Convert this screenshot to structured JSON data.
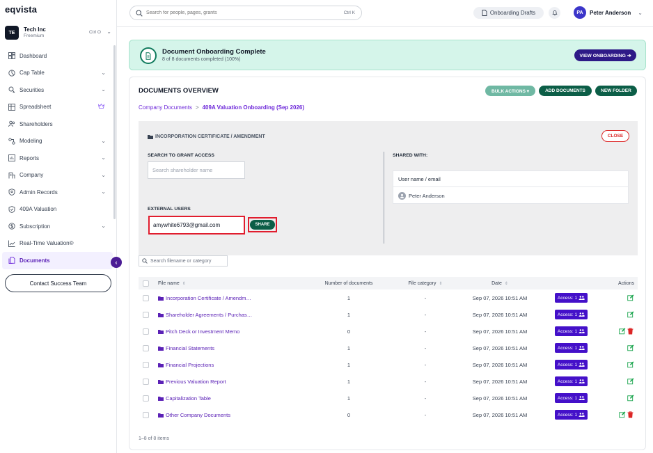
{
  "brand": {
    "logo": "eqvista"
  },
  "org": {
    "initials": "TE",
    "name": "Tech Inc",
    "plan": "Freemium",
    "shortcut": "Ctrl O"
  },
  "nav": [
    {
      "label": "Dashboard",
      "icon": "dashboard-icon",
      "chevron": false
    },
    {
      "label": "Cap Table",
      "icon": "pie-chart-icon",
      "chevron": true
    },
    {
      "label": "Securities",
      "icon": "securities-icon",
      "chevron": true
    },
    {
      "label": "Spreadsheet",
      "icon": "spreadsheet-icon",
      "chevron": false,
      "crown": true
    },
    {
      "label": "Shareholders",
      "icon": "shareholders-icon",
      "chevron": false
    },
    {
      "label": "Modeling",
      "icon": "modeling-icon",
      "chevron": true
    },
    {
      "label": "Reports",
      "icon": "reports-icon",
      "chevron": true
    },
    {
      "label": "Company",
      "icon": "company-icon",
      "chevron": true
    },
    {
      "label": "Admin Records",
      "icon": "admin-records-icon",
      "chevron": true
    },
    {
      "label": "409A Valuation",
      "icon": "shield-check-icon",
      "chevron": false
    },
    {
      "label": "Subscription",
      "icon": "subscription-icon",
      "chevron": true
    },
    {
      "label": "Real-Time Valuation®",
      "icon": "trend-chart-icon",
      "chevron": false
    },
    {
      "label": "Documents",
      "icon": "documents-icon",
      "chevron": false,
      "active": true
    }
  ],
  "contact_button": "Contact Success Team",
  "topbar": {
    "search_placeholder": "Search for people, pages, grants",
    "search_shortcut": "Ctrl K",
    "drafts_label": "Onboarding Drafts",
    "user_initials": "PA",
    "user_name": "Peter Anderson"
  },
  "banner": {
    "title": "Document Onboarding Complete",
    "subtitle": "8 of 8 documents completed (100%)",
    "button": "VIEW ONBOARDING ➔"
  },
  "overview": {
    "title": "DOCUMENTS OVERVIEW",
    "bulk_actions": "BULK ACTIONS ▾",
    "add_documents": "ADD DOCUMENTS",
    "new_folder": "NEW FOLDER",
    "breadcrumb_root": "Company Documents",
    "breadcrumb_sep": ">",
    "breadcrumb_current": "409A Valuation Onboarding (Sep 2026)"
  },
  "share_panel": {
    "folder_title": "INCORPORATION CERTIFICATE / AMENDMENT",
    "close": "CLOSE",
    "search_label": "SEARCH TO GRANT ACCESS",
    "search_placeholder": "Search shareholder name",
    "external_label": "EXTERNAL USERS",
    "external_value": "amywhite6793@gmail.com",
    "share_button": "SHARE",
    "shared_with_label": "SHARED WITH:",
    "shared_header": "User name / email",
    "shared_user": "Peter Anderson"
  },
  "filter_placeholder": "Search filename or category",
  "table": {
    "headers": {
      "name": "File name",
      "count": "Number of documents",
      "category": "File category",
      "date": "Date",
      "actions": "Actions"
    },
    "rows": [
      {
        "name": "Incorporation Certificate / Amendm…",
        "count": "1",
        "category": "-",
        "date": "Sep 07, 2026 10:51 AM",
        "access": "Access: 1",
        "deletable": false
      },
      {
        "name": "Shareholder Agreements / Purchas…",
        "count": "1",
        "category": "-",
        "date": "Sep 07, 2026 10:51 AM",
        "access": "Access: 1",
        "deletable": false
      },
      {
        "name": "Pitch Deck or Investment Memo",
        "count": "0",
        "category": "-",
        "date": "Sep 07, 2026 10:51 AM",
        "access": "Access: 1",
        "deletable": true
      },
      {
        "name": "Financial Statements",
        "count": "1",
        "category": "-",
        "date": "Sep 07, 2026 10:51 AM",
        "access": "Access: 1",
        "deletable": false
      },
      {
        "name": "Financial Projections",
        "count": "1",
        "category": "-",
        "date": "Sep 07, 2026 10:51 AM",
        "access": "Access: 1",
        "deletable": false
      },
      {
        "name": "Previous Valuation Report",
        "count": "1",
        "category": "-",
        "date": "Sep 07, 2026 10:51 AM",
        "access": "Access: 1",
        "deletable": false
      },
      {
        "name": "Capitalization Table",
        "count": "1",
        "category": "-",
        "date": "Sep 07, 2026 10:51 AM",
        "access": "Access: 1",
        "deletable": false
      },
      {
        "name": "Other Company Documents",
        "count": "0",
        "category": "-",
        "date": "Sep 07, 2026 10:51 AM",
        "access": "Access: 1",
        "deletable": true
      }
    ],
    "footer": "1–8 of 8 items"
  },
  "colors": {
    "brand_purple": "#4410c9",
    "brand_green": "#0c5e47",
    "highlight_red": "#e11d2e",
    "banner_bg": "#d5f5ea"
  }
}
